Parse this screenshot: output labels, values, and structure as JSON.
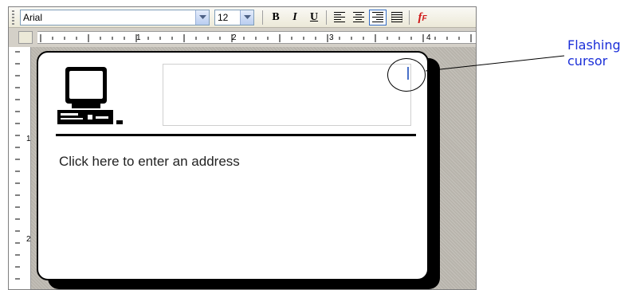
{
  "toolbar": {
    "font_name": "Arial",
    "font_size": "12",
    "bold_label": "B",
    "italic_label": "I",
    "underline_label": "U",
    "align_icons": [
      "align-left-icon",
      "align-center-icon",
      "align-right-icon",
      "justify-icon"
    ],
    "active_alignment": "align-right",
    "special_label": "f",
    "special_sub": "F",
    "special_color": "#d01818"
  },
  "ruler": {
    "horizontal_labels": [
      "1",
      "2",
      "3",
      "4"
    ],
    "vertical_labels": [
      "1",
      "2"
    ]
  },
  "document": {
    "address_prompt": "Click here to enter an address",
    "logo_icon": "computer-icon",
    "card_border_color": "#000000"
  },
  "callout": {
    "line1": "Flashing",
    "line2": "cursor",
    "color": "#1a2ed8"
  }
}
